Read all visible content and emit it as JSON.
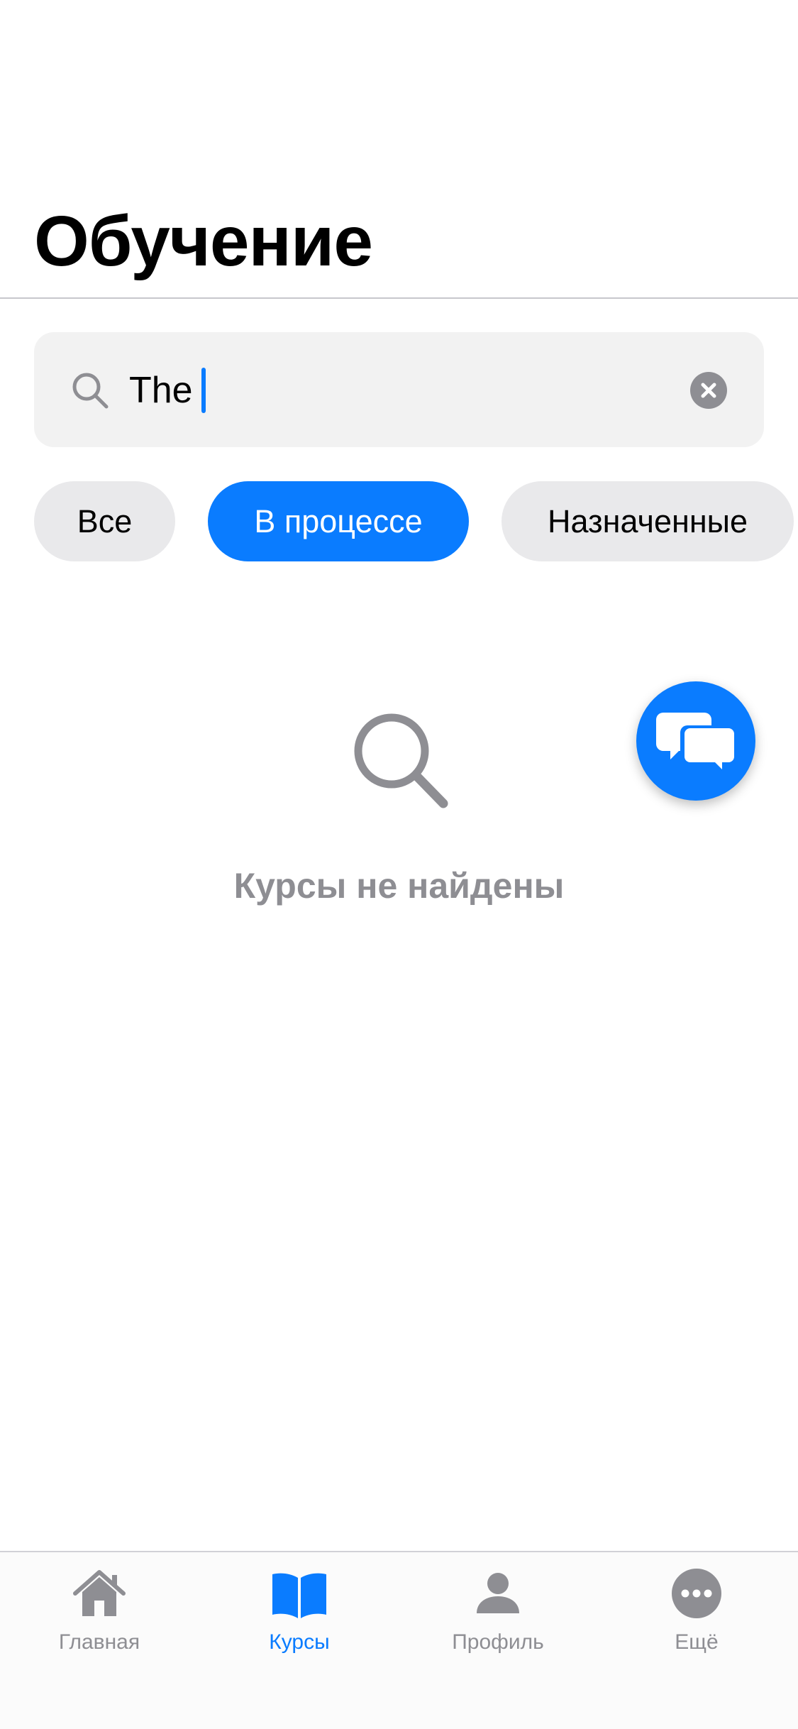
{
  "page": {
    "title": "Обучение"
  },
  "search": {
    "value": "The",
    "clear_icon": "clear-circle-icon",
    "search_icon": "magnifier-icon"
  },
  "filters": {
    "chips": [
      {
        "label": "Все",
        "selected": false
      },
      {
        "label": "В процессе",
        "selected": true
      },
      {
        "label": "Назначенные",
        "selected": false
      }
    ]
  },
  "empty_state": {
    "icon": "magnifier-icon",
    "message": "Курсы не найдены"
  },
  "fab": {
    "icon": "chat-bubbles-icon"
  },
  "tabbar": {
    "items": [
      {
        "label": "Главная",
        "icon": "home-icon",
        "active": false
      },
      {
        "label": "Курсы",
        "icon": "book-icon",
        "active": true
      },
      {
        "label": "Профиль",
        "icon": "person-icon",
        "active": false
      },
      {
        "label": "Ещё",
        "icon": "more-icon",
        "active": false
      }
    ]
  },
  "colors": {
    "accent": "#0a7cff",
    "inactive": "#8e8e93",
    "chip_bg": "#e9e9eb",
    "search_bg": "#f2f2f2"
  }
}
